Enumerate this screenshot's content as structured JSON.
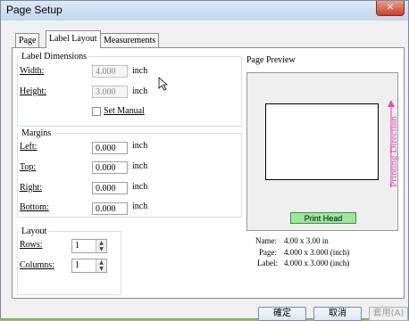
{
  "window": {
    "title": "Page Setup",
    "close_glyph": "✕"
  },
  "tabs": [
    "Page",
    "Label Layout",
    "Measurements"
  ],
  "label_dimensions": {
    "legend": "Label Dimensions",
    "width_label": "Width:",
    "width_value": "4.000",
    "height_label": "Height:",
    "height_value": "3.000",
    "unit": "inch",
    "set_manual_label": "Set Manual",
    "set_manual_checked": false
  },
  "margins": {
    "legend": "Margins",
    "left_label": "Left:",
    "left_value": "0.000",
    "top_label": "Top:",
    "top_value": "0.000",
    "right_label": "Right:",
    "right_value": "0.000",
    "bottom_label": "Bottom:",
    "bottom_value": "0.000",
    "unit": "inch"
  },
  "layout": {
    "legend": "Layout",
    "rows_label": "Rows:",
    "rows_value": "1",
    "columns_label": "Columns:",
    "columns_value": "1"
  },
  "preview": {
    "legend": "Page Preview",
    "print_head_label": "Print Head",
    "printing_direction_label": "Printing Direction",
    "name_label": "Name:",
    "name_value": "4.00 x 3.00 in",
    "page_label": "Page:",
    "page_value": "4.000 x 3.000 (inch)",
    "label_label": "Label:",
    "label_value": "4.000 x 3.000 (inch)"
  },
  "buttons": {
    "ok": "確定",
    "cancel": "取消",
    "apply": "套用(A)"
  },
  "icons": {
    "close": "close-icon",
    "cursor": "mouse-pointer-icon",
    "spin_up": "spin-up-icon",
    "spin_down": "spin-down-icon",
    "arrow": "arrow-up-icon"
  }
}
